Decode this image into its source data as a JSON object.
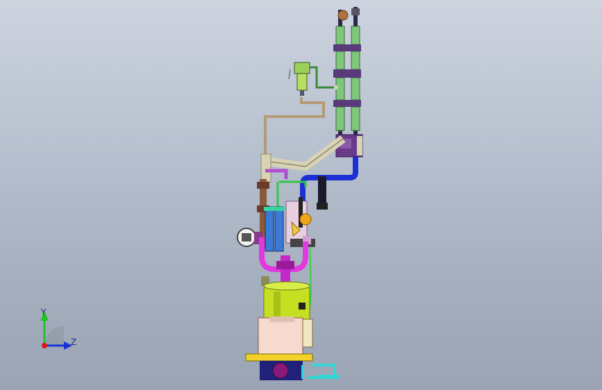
{
  "viewport": {
    "background_top": "#cdd4df",
    "background_bottom": "#9aa4b4"
  },
  "triad": {
    "y_label": "Y",
    "z_label": "Z",
    "y_color": "#22c22a",
    "z_color": "#1a33d8",
    "x_color": "#d81818"
  },
  "model": {
    "colors": {
      "column_green": "#7fc77b",
      "column_purple": "#6a3a8a",
      "pipe_beige": "#d8d3b4",
      "pipe_blue": "#1c2fd4",
      "pipe_magenta": "#e238e0",
      "pipe_cyan": "#33d6d6",
      "tank_yellow": "#c7df22",
      "base_pink": "#f7d9cf",
      "base_navy": "#20227a",
      "valve_orange": "#f0a818",
      "pipe_brown": "#8a5a3a"
    }
  }
}
